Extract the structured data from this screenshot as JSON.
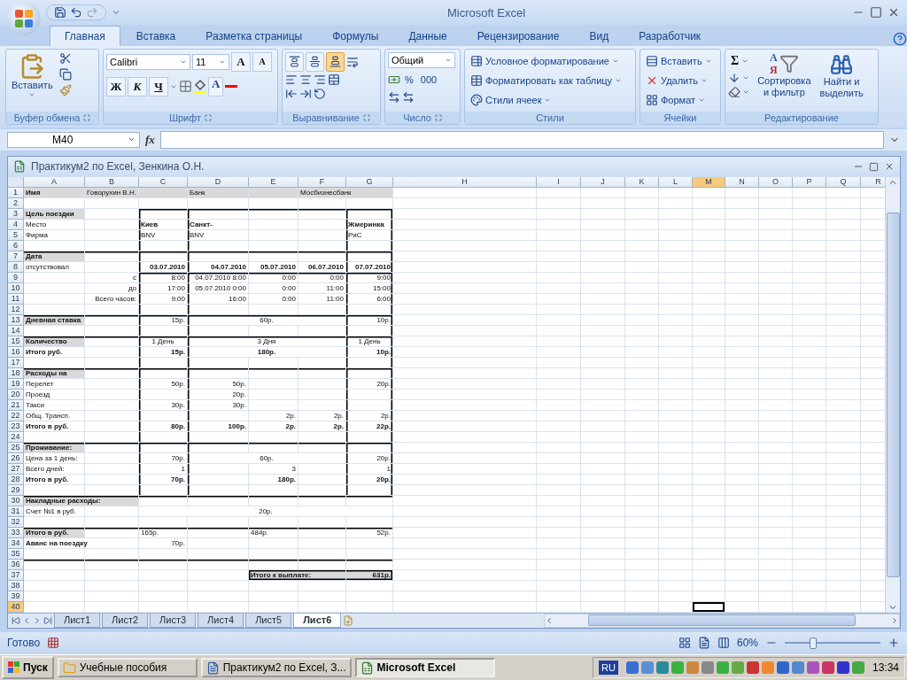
{
  "window": {
    "title": "Microsoft Excel"
  },
  "tabs": [
    {
      "label": "Главная",
      "selected": true
    },
    {
      "label": "Вставка",
      "selected": false
    },
    {
      "label": "Разметка страницы",
      "selected": false
    },
    {
      "label": "Формулы",
      "selected": false
    },
    {
      "label": "Данные",
      "selected": false
    },
    {
      "label": "Рецензирование",
      "selected": false
    },
    {
      "label": "Вид",
      "selected": false
    },
    {
      "label": "Разработчик",
      "selected": false
    }
  ],
  "ribbon": {
    "clipboard": {
      "label": "Буфер обмена",
      "paste": "Вставить"
    },
    "font": {
      "label": "Шрифт",
      "font_name": "Calibri",
      "font_size": "11",
      "grow": "A",
      "shrink": "A",
      "bold": "Ж",
      "italic": "К",
      "underline": "Ч",
      "font_color_letter": "A"
    },
    "alignment": {
      "label": "Выравнивание",
      "vertical": [
        {
          "selected": false
        },
        {
          "selected": false
        },
        {
          "selected": true
        }
      ]
    },
    "number": {
      "label": "Число",
      "format": "Общий",
      "percent": "%",
      "thousands": "000"
    },
    "styles": {
      "label": "Стили",
      "items": [
        "Условное форматирование",
        "Форматировать как таблицу",
        "Стили ячеек"
      ]
    },
    "cells": {
      "label": "Ячейки",
      "items": [
        "Вставить",
        "Удалить",
        "Формат"
      ]
    },
    "editing": {
      "label": "Редактирование",
      "sum": "Σ",
      "sort_glyphs": [
        "A",
        "Я"
      ],
      "sort": [
        "Сортировка",
        "и фильтр"
      ],
      "find": [
        "Найти и",
        "выделить"
      ]
    }
  },
  "formula_bar": {
    "name_box": "M40",
    "fx": "fx"
  },
  "workbook": {
    "title": "Практикум2 по Excel, Зенкина О.Н.",
    "columns": [
      {
        "label": "A",
        "selected": false
      },
      {
        "label": "B",
        "selected": false
      },
      {
        "label": "C",
        "selected": false
      },
      {
        "label": "D",
        "selected": false
      },
      {
        "label": "E",
        "selected": false
      },
      {
        "label": "F",
        "selected": false
      },
      {
        "label": "G",
        "selected": false
      },
      {
        "label": "H",
        "selected": false
      },
      {
        "label": "I",
        "selected": false
      },
      {
        "label": "J",
        "selected": false
      },
      {
        "label": "K",
        "selected": false
      },
      {
        "label": "L",
        "selected": false
      },
      {
        "label": "M",
        "selected": true
      },
      {
        "label": "N",
        "selected": false
      },
      {
        "label": "O",
        "selected": false
      },
      {
        "label": "P",
        "selected": false
      },
      {
        "label": "Q",
        "selected": false
      },
      {
        "label": "R",
        "selected": false
      }
    ],
    "rows": [
      {
        "num": "1",
        "selected": false,
        "cells": {
          "a": {
            "text": "Имя",
            "bold": true
          },
          "b": {
            "text": "Говорухин В.Н.",
            "bold": false
          },
          "d": {
            "text": "Банк",
            "bold": false
          },
          "f": {
            "text": "Мосбизнесбанк",
            "bold": false
          }
        }
      },
      {
        "num": "2",
        "selected": false,
        "cells": {}
      },
      {
        "num": "3",
        "selected": false,
        "cells": {
          "a": {
            "text": "Цель поездки",
            "bold": true
          }
        }
      },
      {
        "num": "4",
        "selected": false,
        "cells": {
          "a": {
            "text": "Место",
            "bold": false
          },
          "c": {
            "text": "Киев",
            "bold": true
          },
          "d": {
            "text": "Санкт-",
            "bold": true
          },
          "g": {
            "text": "Жмеринка",
            "bold": true
          }
        }
      },
      {
        "num": "5",
        "selected": false,
        "cells": {
          "a": {
            "text": "Фирма",
            "bold": false
          },
          "c": {
            "text": "BNV",
            "bold": false
          },
          "d": {
            "text": "BNV",
            "bold": false
          },
          "g": {
            "text": "РиС",
            "bold": false
          }
        }
      },
      {
        "num": "6",
        "selected": false,
        "cells": {}
      },
      {
        "num": "7",
        "selected": false,
        "cells": {
          "a": {
            "text": "Дата",
            "bold": true
          }
        }
      },
      {
        "num": "8",
        "selected": false,
        "cells": {
          "a": {
            "text": "отсутствовал",
            "bold": false
          },
          "c": {
            "text": "03.07.2010",
            "bold": true
          },
          "d": {
            "text": "04.07.2010",
            "bold": true
          },
          "e": {
            "text": "05.07.2010",
            "bold": true
          },
          "f": {
            "text": "06.07.2010",
            "bold": true
          },
          "g": {
            "text": "07.07.2010",
            "bold": true
          }
        }
      },
      {
        "num": "9",
        "selected": false,
        "cells": {
          "b": {
            "text": "с",
            "bold": false
          },
          "c": {
            "text": "8:00",
            "bold": false
          },
          "d": {
            "text": "04.07.2010 8:00",
            "bold": false
          },
          "e": {
            "text": "0:00",
            "bold": false
          },
          "f": {
            "text": "0:00",
            "bold": false
          },
          "g": {
            "text": "9:00",
            "bold": false
          }
        }
      },
      {
        "num": "10",
        "selected": false,
        "cells": {
          "b": {
            "text": "до",
            "bold": false
          },
          "c": {
            "text": "17:00",
            "bold": false
          },
          "d": {
            "text": "05.07.2010 0:00",
            "bold": false
          },
          "e": {
            "text": "0:00",
            "bold": false
          },
          "f": {
            "text": "11:00",
            "bold": false
          },
          "g": {
            "text": "15:00",
            "bold": false
          }
        }
      },
      {
        "num": "11",
        "selected": false,
        "cells": {
          "b": {
            "text": "Всего часов:",
            "bold": false
          },
          "c": {
            "text": "9:00",
            "bold": false
          },
          "d": {
            "text": "16:00",
            "bold": false
          },
          "e": {
            "text": "0:00",
            "bold": false
          },
          "f": {
            "text": "11:00",
            "bold": false
          },
          "g": {
            "text": "6:00",
            "bold": false
          }
        }
      },
      {
        "num": "12",
        "selected": false,
        "cells": {}
      },
      {
        "num": "13",
        "selected": false,
        "cells": {
          "a": {
            "text": "Дневная ставка",
            "bold": true
          },
          "c": {
            "text": "15р.",
            "bold": false
          },
          "d": {
            "text": "60р.",
            "bold": false
          },
          "g": {
            "text": "10р.",
            "bold": false
          }
        }
      },
      {
        "num": "14",
        "selected": false,
        "cells": {}
      },
      {
        "num": "15",
        "selected": false,
        "cells": {
          "a": {
            "text": "Количество",
            "bold": true
          },
          "c": {
            "text": "1  День",
            "bold": false
          },
          "d": {
            "text": "3  Дня",
            "bold": false
          },
          "g": {
            "text": "1  День",
            "bold": false
          }
        }
      },
      {
        "num": "16",
        "selected": false,
        "cells": {
          "a": {
            "text": "Итого руб.",
            "bold": true
          },
          "c": {
            "text": "15р.",
            "bold": true
          },
          "d": {
            "text": "180р.",
            "bold": true
          },
          "g": {
            "text": "10р.",
            "bold": true
          }
        }
      },
      {
        "num": "17",
        "selected": false,
        "cells": {}
      },
      {
        "num": "18",
        "selected": false,
        "cells": {
          "a": {
            "text": "Расходы на",
            "bold": true
          }
        }
      },
      {
        "num": "19",
        "selected": false,
        "cells": {
          "a": {
            "text": "Перелет",
            "bold": false
          },
          "c": {
            "text": "50р.",
            "bold": false
          },
          "d": {
            "text": "50р.",
            "bold": false
          },
          "g": {
            "text": "20р.",
            "bold": false
          }
        }
      },
      {
        "num": "20",
        "selected": false,
        "cells": {
          "a": {
            "text": "Проезд",
            "bold": false
          },
          "d": {
            "text": "20р.",
            "bold": false
          }
        }
      },
      {
        "num": "21",
        "selected": false,
        "cells": {
          "a": {
            "text": "Такси",
            "bold": false
          },
          "c": {
            "text": "30р.",
            "bold": false
          },
          "d": {
            "text": "30р.",
            "bold": false
          }
        }
      },
      {
        "num": "22",
        "selected": false,
        "cells": {
          "a": {
            "text": "Общ. Трансп.",
            "bold": false
          },
          "e": {
            "text": "2р.",
            "bold": false
          },
          "f": {
            "text": "2р.",
            "bold": false
          },
          "g": {
            "text": "2р.",
            "bold": false
          }
        }
      },
      {
        "num": "23",
        "selected": false,
        "cells": {
          "a": {
            "text": "Итого в руб.",
            "bold": true
          },
          "c": {
            "text": "80р.",
            "bold": true
          },
          "d": {
            "text": "100р.",
            "bold": true
          },
          "e": {
            "text": "2р.",
            "bold": true
          },
          "f": {
            "text": "2р.",
            "bold": true
          },
          "g": {
            "text": "22р.",
            "bold": true
          }
        }
      },
      {
        "num": "24",
        "selected": false,
        "cells": {}
      },
      {
        "num": "25",
        "selected": false,
        "cells": {
          "a": {
            "text": "Проживание:",
            "bold": true
          }
        }
      },
      {
        "num": "26",
        "selected": false,
        "cells": {
          "a": {
            "text": "Цена за 1 день:",
            "bold": false
          },
          "c": {
            "text": "70р.",
            "bold": false
          },
          "d": {
            "text": "60р.",
            "bold": false
          },
          "g": {
            "text": "20р.",
            "bold": false
          }
        }
      },
      {
        "num": "27",
        "selected": false,
        "cells": {
          "a": {
            "text": "Всего дней:",
            "bold": false
          },
          "c": {
            "text": "1",
            "bold": false
          },
          "e": {
            "text": "3",
            "bold": false
          },
          "g": {
            "text": "1",
            "bold": false
          }
        }
      },
      {
        "num": "28",
        "selected": false,
        "cells": {
          "a": {
            "text": "Итого в руб.",
            "bold": true
          },
          "c": {
            "text": "70р.",
            "bold": true
          },
          "e": {
            "text": "180р.",
            "bold": true
          },
          "g": {
            "text": "20р.",
            "bold": true
          }
        }
      },
      {
        "num": "29",
        "selected": false,
        "cells": {}
      },
      {
        "num": "30",
        "selected": false,
        "cells": {
          "a": {
            "text": "Накладные расходы:",
            "bold": true
          }
        }
      },
      {
        "num": "31",
        "selected": false,
        "cells": {
          "a": {
            "text": "Счет №1 в руб.",
            "bold": false
          },
          "c": {
            "text": "20р.",
            "bold": false
          }
        }
      },
      {
        "num": "32",
        "selected": false,
        "cells": {}
      },
      {
        "num": "33",
        "selected": false,
        "cells": {
          "a": {
            "text": "Итого в руб.",
            "bold": true
          },
          "c": {
            "text": "165р.",
            "bold": false
          },
          "e": {
            "text": "484р.",
            "bold": false
          },
          "g": {
            "text": "52р.",
            "bold": false
          }
        }
      },
      {
        "num": "34",
        "selected": false,
        "cells": {
          "a": {
            "text": "Аванс на поездку",
            "bold": true
          },
          "c": {
            "text": "70р.",
            "bold": false
          }
        }
      },
      {
        "num": "35",
        "selected": false,
        "cells": {}
      },
      {
        "num": "36",
        "selected": false,
        "cells": {}
      },
      {
        "num": "37",
        "selected": false,
        "cells": {
          "e": {
            "text": "Итого к выплате:",
            "bold": true
          },
          "g": {
            "text": "631р.",
            "bold": true
          }
        }
      },
      {
        "num": "38",
        "selected": false,
        "cells": {}
      },
      {
        "num": "39",
        "selected": false,
        "cells": {}
      },
      {
        "num": "40",
        "selected": true,
        "cells": {}
      }
    ],
    "sheet_tabs": [
      {
        "label": "Лист1",
        "selected": false
      },
      {
        "label": "Лист2",
        "selected": false
      },
      {
        "label": "Лист3",
        "selected": false
      },
      {
        "label": "Лист4",
        "selected": false
      },
      {
        "label": "Лист5",
        "selected": false
      },
      {
        "label": "Лист6",
        "selected": true
      }
    ]
  },
  "status_bar": {
    "mode": "Готово",
    "zoom": "60%",
    "zoom_slider": {
      "level": 0.3
    }
  },
  "taskbar": {
    "start": "Пуск",
    "tasks": [
      {
        "label": "Учебные пособия",
        "kind": "folder",
        "selected": false
      },
      {
        "label": "Практикум2 по Excel, З...",
        "kind": "document",
        "selected": false
      },
      {
        "label": "Microsoft Excel",
        "kind": "excel",
        "selected": true
      }
    ],
    "language": "RU",
    "clock": "13:34"
  }
}
